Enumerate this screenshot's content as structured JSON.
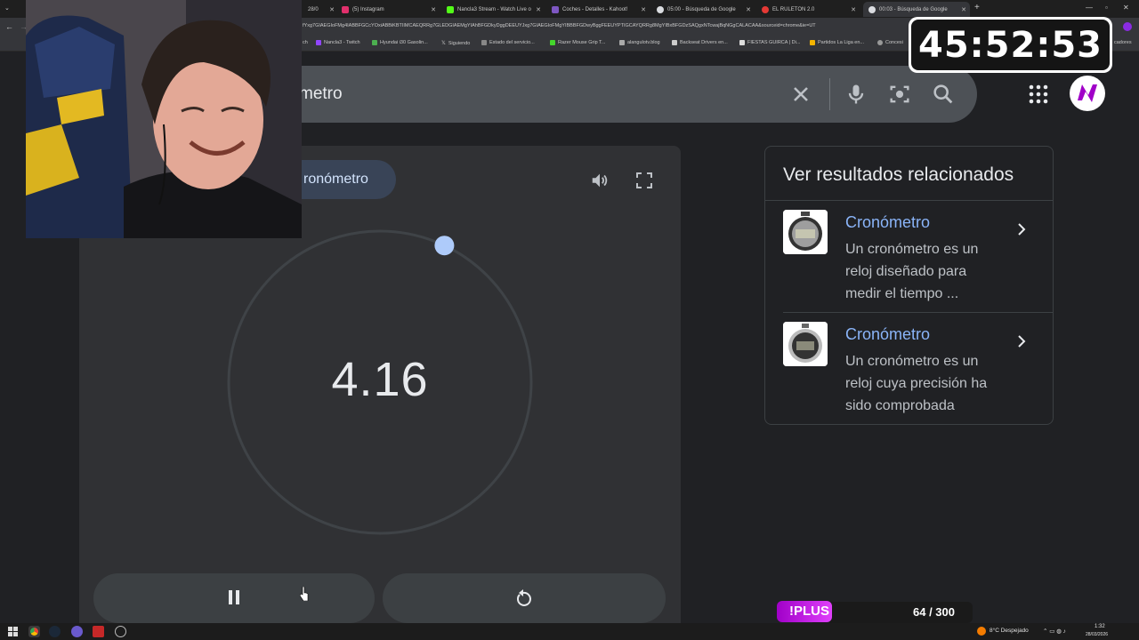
{
  "browser": {
    "tabs": [
      {
        "label": "28/0",
        "color": "#2d2d2d"
      },
      {
        "label": "(5) Instagram",
        "color": "#e1306c"
      },
      {
        "label": "Nancla3 Stream - Watch Live o",
        "color": "#53fc18"
      },
      {
        "label": "Coches - Detalles - Kahoot!",
        "color": "#46178f"
      },
      {
        "label": "05:00 - Búsqueda de Google",
        "color": "#9aa0a6"
      },
      {
        "label": "EL RULETON 2.0",
        "color": "#e53935"
      },
      {
        "label": "00:03 - Búsqueda de Google",
        "color": "#9aa0a6"
      }
    ],
    "url": "fYxg7GIAEGIoFMg4IABBFGCcYOxiABBiKBTIIMCAEQRRg7GLEDGIAEMgYIAhBFGDkyDggDEEUYJxg7GIAEGIoFMgYIBBBFGDwyBggFEEUYPTIGCAYQRRg8MgYIBxBFGDzSAQgxNTcwajBqNGgCALACAA&sourceid=chrome&ie=UT",
    "bookmarks": [
      "ch",
      "Nancla3 - Twitch",
      "Hyundai i30 Gasolin...",
      "Siguiendo",
      "Estado del servicio...",
      "Razer Mouse Grip T...",
      "alangulotv.blog",
      "Backseat Drivers en...",
      "FIESTAS GUIRCA | Di...",
      "Partidos La Liga en...",
      "Concesi",
      "cadores"
    ]
  },
  "search": {
    "query": "metro",
    "clear_icon": "close-icon",
    "voice_icon": "microphone-icon",
    "lens_icon": "camera-lens-icon",
    "search_icon": "search-icon"
  },
  "stopwatch": {
    "tab_label": "ronómetro",
    "time": "4.16",
    "progress_fraction": 0.07
  },
  "related": {
    "title": "Ver resultados relacionados",
    "items": [
      {
        "link": "Cronómetro",
        "desc": "Un cronómetro es un reloj diseñado para medir el tiempo ..."
      },
      {
        "link": "Cronómetro",
        "desc": "Un cronómetro es un reloj cuya precisión ha sido comprobada"
      }
    ]
  },
  "overlays": {
    "timer": "45:52:53",
    "plus_label": "!PLUS",
    "plus_count": "64 / 300",
    "plus_fraction": 0.213
  },
  "taskbar": {
    "weather": "8°C  Despejado",
    "time": "1:32",
    "date": "28/03/2026"
  },
  "colors": {
    "accent": "#8ab4f8",
    "brand_purple": "#e040fb"
  }
}
